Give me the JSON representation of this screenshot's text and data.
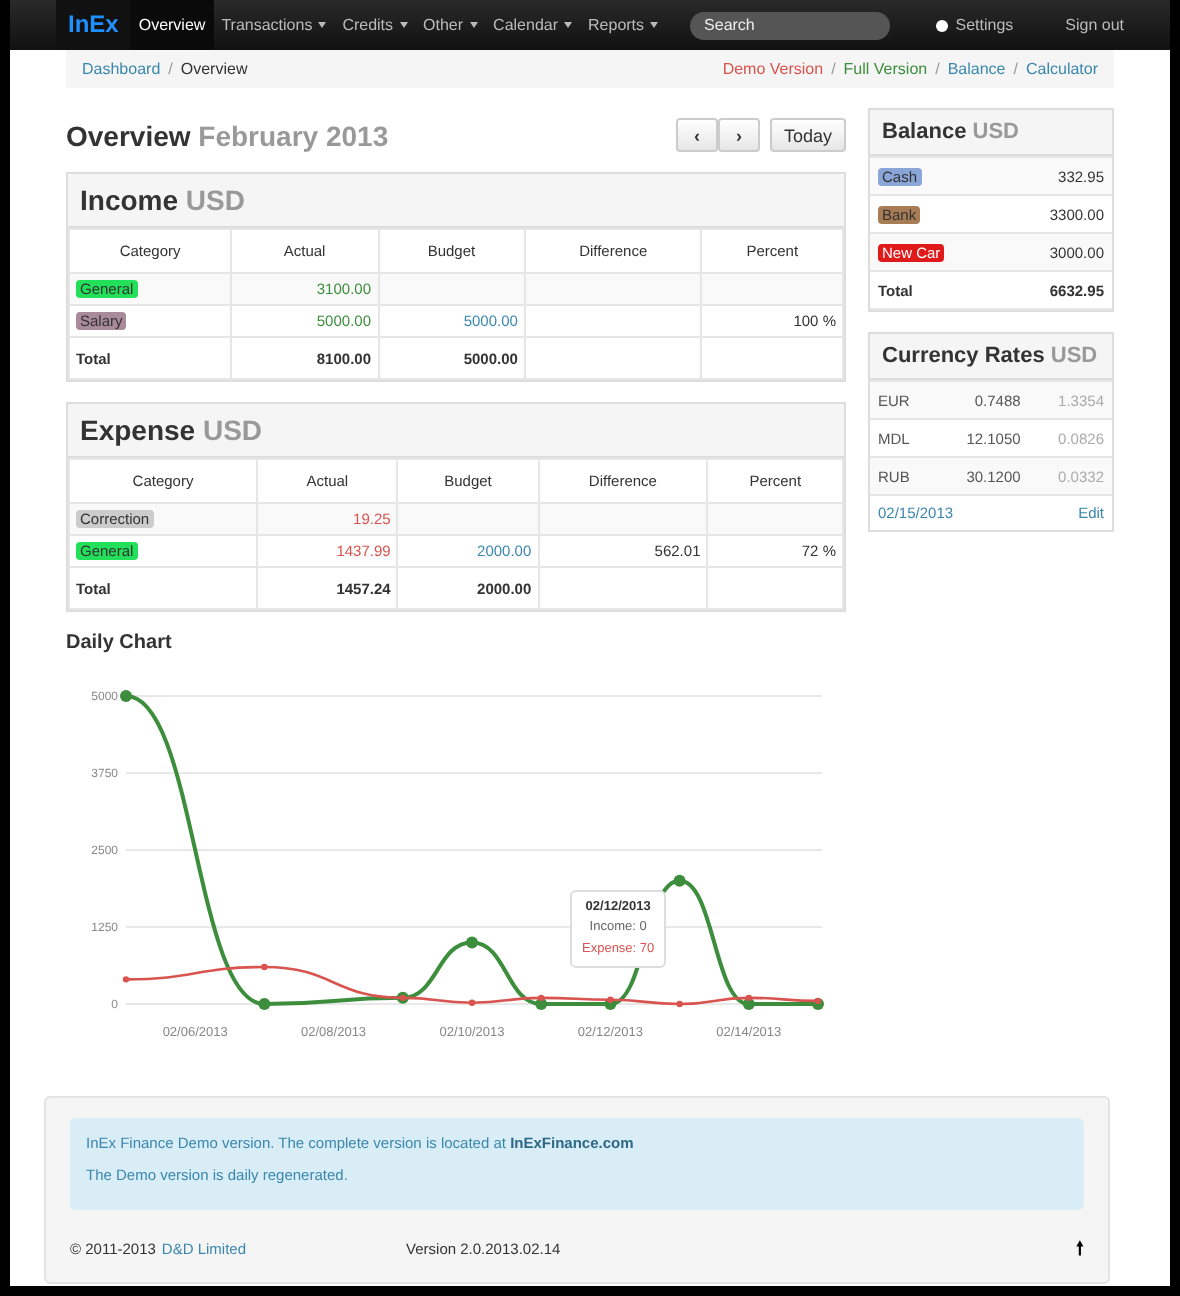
{
  "navbar": {
    "brand": "InEx",
    "items": [
      {
        "label": "Overview",
        "selected": true,
        "dropdown": false
      },
      {
        "label": "Transactions",
        "selected": false,
        "dropdown": true
      },
      {
        "label": "Credits",
        "selected": false,
        "dropdown": true
      },
      {
        "label": "Other",
        "selected": false,
        "dropdown": true
      },
      {
        "label": "Calendar",
        "selected": false,
        "dropdown": true
      },
      {
        "label": "Reports",
        "selected": false,
        "dropdown": true
      }
    ],
    "search": {
      "placeholder": "Search"
    },
    "settings": "Settings",
    "sign_out": "Sign out"
  },
  "breadcrumb": {
    "items": [
      "Dashboard",
      "Overview"
    ],
    "separator": "/",
    "links_separator": "/",
    "links": [
      {
        "label": "Demo Version",
        "color": "#d9534f"
      },
      {
        "label": "Full Version",
        "color": "#3c8d3c"
      },
      {
        "label": "Balance",
        "color": "#3a87ad"
      },
      {
        "label": "Calculator",
        "color": "#3a87ad"
      }
    ]
  },
  "page_title": {
    "title": "Overview",
    "period": "February 2013",
    "prev": "‹",
    "next": "›",
    "today": "Today"
  },
  "tables": [
    {
      "kind": "income",
      "title": "Income",
      "currency": "USD",
      "columns": [
        "Category",
        "Actual",
        "Budget",
        "Difference",
        "Percent"
      ],
      "rows": [
        {
          "category": "General",
          "color": "#22e05a",
          "actual": "3100.00",
          "budget": "",
          "difference": "",
          "percent": ""
        },
        {
          "category": "Salary",
          "color": "#a88a9a",
          "actual": "5000.00",
          "budget": "5000.00",
          "difference": "",
          "percent": "100 %"
        }
      ],
      "total": {
        "label": "Total",
        "actual": "8100.00",
        "budget": "5000.00"
      }
    },
    {
      "kind": "expense",
      "title": "Expense",
      "currency": "USD",
      "columns": [
        "Category",
        "Actual",
        "Budget",
        "Difference",
        "Percent"
      ],
      "rows": [
        {
          "category": "Correction",
          "color": "#cccccc",
          "actual": "19.25",
          "budget": "",
          "difference": "",
          "percent": ""
        },
        {
          "category": "General",
          "color": "#22e05a",
          "actual": "1437.99",
          "budget": "2000.00",
          "difference": "562.01",
          "percent": "72 %"
        }
      ],
      "total": {
        "label": "Total",
        "actual": "1457.24",
        "budget": "2000.00"
      }
    }
  ],
  "daily_chart": {
    "title": "Daily Chart",
    "chart_data": {
      "type": "line",
      "categories": [
        null,
        "02/06/2013",
        null,
        "02/08/2013",
        null,
        "02/10/2013",
        null,
        "02/12/2013",
        null,
        "02/14/2013",
        null
      ],
      "series": [
        {
          "color": "#3c8d3c",
          "marker": true,
          "values": [
            5000,
            null,
            0,
            null,
            100,
            1000,
            0,
            0,
            2000,
            0,
            0
          ]
        },
        {
          "color": "#d9534f",
          "marker": true,
          "values": [
            400,
            null,
            600,
            null,
            100,
            20,
            100,
            70,
            0,
            100,
            50
          ]
        }
      ],
      "grid": true,
      "ylim": [
        0,
        5000
      ],
      "yticks": [
        0,
        1250,
        2500,
        3750,
        5000
      ]
    },
    "tooltip": {
      "title": "02/12/2013",
      "income": "Income: 0",
      "expense": "Expense: 70"
    }
  },
  "balance": {
    "title": "Balance",
    "currency": "USD",
    "rows": [
      {
        "label": "Cash",
        "color": "#8aa6d8",
        "amount": "332.95"
      },
      {
        "label": "Bank",
        "color": "#a87c55",
        "amount": "3300.00"
      },
      {
        "label": "New Car",
        "color": "#e01a1a",
        "amount": "3000.00"
      }
    ],
    "total": {
      "label": "Total",
      "amount": "6632.95"
    }
  },
  "currency_rates": {
    "title": "Currency Rates",
    "currency": "USD",
    "rows": [
      {
        "code": "EUR",
        "rate": "0.7488",
        "inverse": "1.3354"
      },
      {
        "code": "MDL",
        "rate": "12.1050",
        "inverse": "0.0826"
      },
      {
        "code": "RUB",
        "rate": "30.1200",
        "inverse": "0.0332"
      }
    ],
    "date": "02/15/2013",
    "edit": "Edit"
  },
  "footer": {
    "notice": "InEx Finance Demo version. The complete version is located at **InExFinance.com**",
    "notice_2": "The Demo version is daily regenerated.",
    "copyright": "© 2011-2013",
    "company": "D&D Limited",
    "version": "Version 2.0.2013.02.14",
    "top": "🠕"
  }
}
